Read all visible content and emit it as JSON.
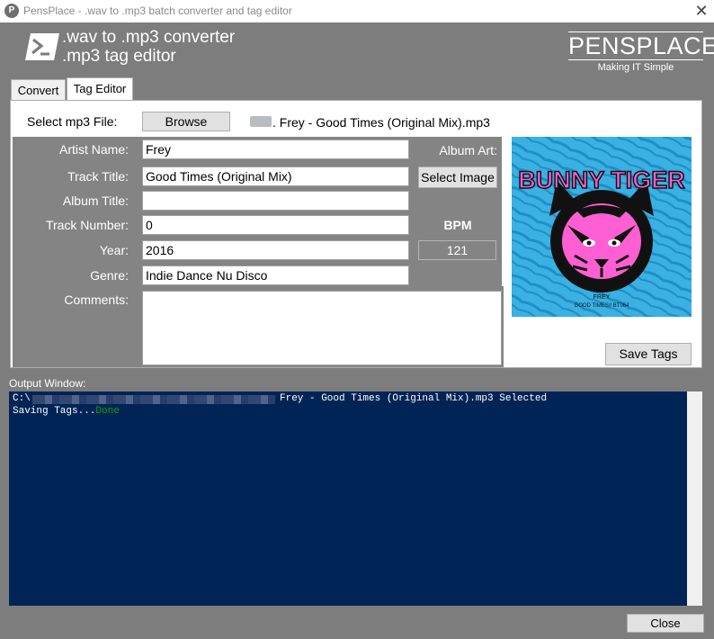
{
  "window": {
    "icon_letter": "P",
    "title": "PensPlace - .wav to .mp3  batch converter and tag editor",
    "close_glyph": "✕"
  },
  "header": {
    "line1": ".wav to .mp3 converter",
    "line2": ".mp3 tag editor",
    "brand_name": "PENSPLACE",
    "brand_tagline": "Making IT Simple"
  },
  "tabs": [
    {
      "label": "Convert",
      "active": false
    },
    {
      "label": "Tag Editor",
      "active": true
    }
  ],
  "tag_editor": {
    "select_file_label": "Select mp3 File:",
    "browse_label": "Browse",
    "file_name": ". Frey - Good Times (Original Mix).mp3",
    "fields": {
      "artist_label": "Artist Name:",
      "artist_value": "Frey",
      "track_title_label": "Track Title:",
      "track_title_value": "Good Times (Original Mix)",
      "album_title_label": "Album Title:",
      "album_title_value": "",
      "track_number_label": "Track Number:",
      "track_number_value": "0",
      "year_label": "Year:",
      "year_value": "2016",
      "genre_label": "Genre:",
      "genre_value": "Indie Dance   Nu Disco",
      "comments_label": "Comments:",
      "comments_value": ""
    },
    "album_art_label": "Album Art:",
    "select_image_label": "Select Image",
    "bpm_label": "BPM",
    "bpm_value": "121",
    "save_tags_label": "Save Tags",
    "album_art": {
      "title": "BUNNY TIGER",
      "artist": "FREY",
      "catalog": "GOOD TIMES// BT064"
    }
  },
  "output": {
    "label": "Output Window:",
    "line1_prefix": "C:\\",
    "line1_file": "Frey - Good Times (Original Mix).mp3 Selected",
    "line2_text": "Saving Tags...",
    "line2_status": "Done"
  },
  "footer": {
    "close_label": "Close"
  },
  "colors": {
    "background": "#7d7d7d",
    "output_bg": "#012456",
    "done_green": "#13a10e",
    "album_art_bg": "#3ab0e3",
    "album_art_pink": "#ff5fd2"
  }
}
